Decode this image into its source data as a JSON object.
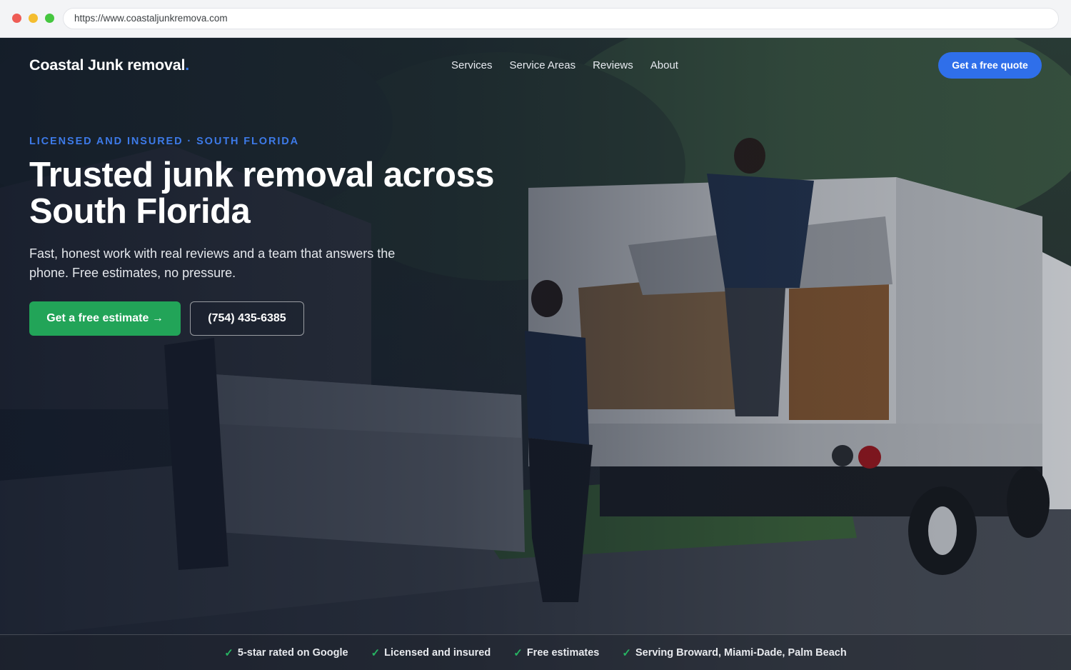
{
  "browser": {
    "url": "https://www.coastaljunkremova.com"
  },
  "header": {
    "logo_text": "Coastal Junk removal",
    "logo_dot": ".",
    "nav": [
      {
        "label": "Services"
      },
      {
        "label": "Service Areas"
      },
      {
        "label": "Reviews"
      },
      {
        "label": "About"
      }
    ],
    "cta_label": "Get a free quote"
  },
  "hero": {
    "eyebrow": "LICENSED AND INSURED · SOUTH FLORIDA",
    "headline_line1": "Trusted junk removal across",
    "headline_line2": "South Florida",
    "subtext": "Fast, honest work with real reviews and a team that answers the phone. Free estimates, no pressure.",
    "primary_button": "Get a free estimate →",
    "phone_button": "(754) 435-6385"
  },
  "trust_bar": [
    {
      "icon": "check-icon",
      "label": "5-star rated on Google"
    },
    {
      "icon": "check-icon",
      "label": "Licensed and insured"
    },
    {
      "icon": "check-icon",
      "label": "Free estimates"
    },
    {
      "icon": "check-icon",
      "label": "Serving Broward, Miami-Dade, Palm Beach"
    }
  ],
  "colors": {
    "accent_blue": "#2f6fea",
    "eyebrow_blue": "#3d7ae8",
    "cta_green": "#22a458",
    "check_green": "#27b362"
  },
  "check_glyph": "✓"
}
